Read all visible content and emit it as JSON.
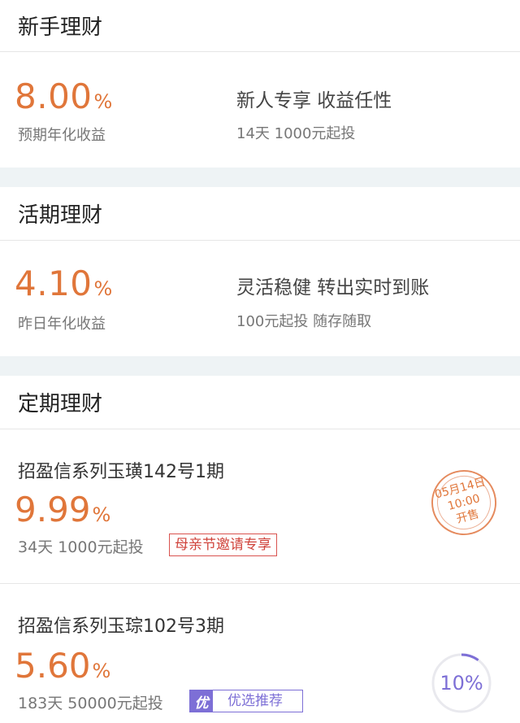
{
  "newbie": {
    "title": "新手理财",
    "rate": "8.00",
    "pct": "%",
    "rate_label": "预期年化收益",
    "desc_title": "新人专享 收益任性",
    "desc_sub": "14天 1000元起投"
  },
  "current": {
    "title": "活期理财",
    "rate": "4.10",
    "pct": "%",
    "rate_label": "昨日年化收益",
    "desc_title": "灵活稳健 转出实时到账",
    "desc_sub": "100元起投 随存随取"
  },
  "fixed": {
    "title": "定期理财",
    "items": [
      {
        "name": "招盈信系列玉璜142号1期",
        "rate": "9.99",
        "pct": "%",
        "terms": "34天 1000元起投",
        "tag": "母亲节邀请专享",
        "stamp_date": "05月14日",
        "stamp_time": "10:00",
        "stamp_text": "开售"
      },
      {
        "name": "招盈信系列玉琮102号3期",
        "rate": "5.60",
        "pct": "%",
        "terms": "183天 50000元起投",
        "tag_icon": "优",
        "tag": "优选推荐",
        "progress_label": "10%",
        "progress": 0.1
      }
    ]
  },
  "colors": {
    "accent_orange": "#e0763a",
    "accent_purple": "#7d6fd6",
    "tag_red": "#d0443c",
    "background": "#eef3f5"
  }
}
